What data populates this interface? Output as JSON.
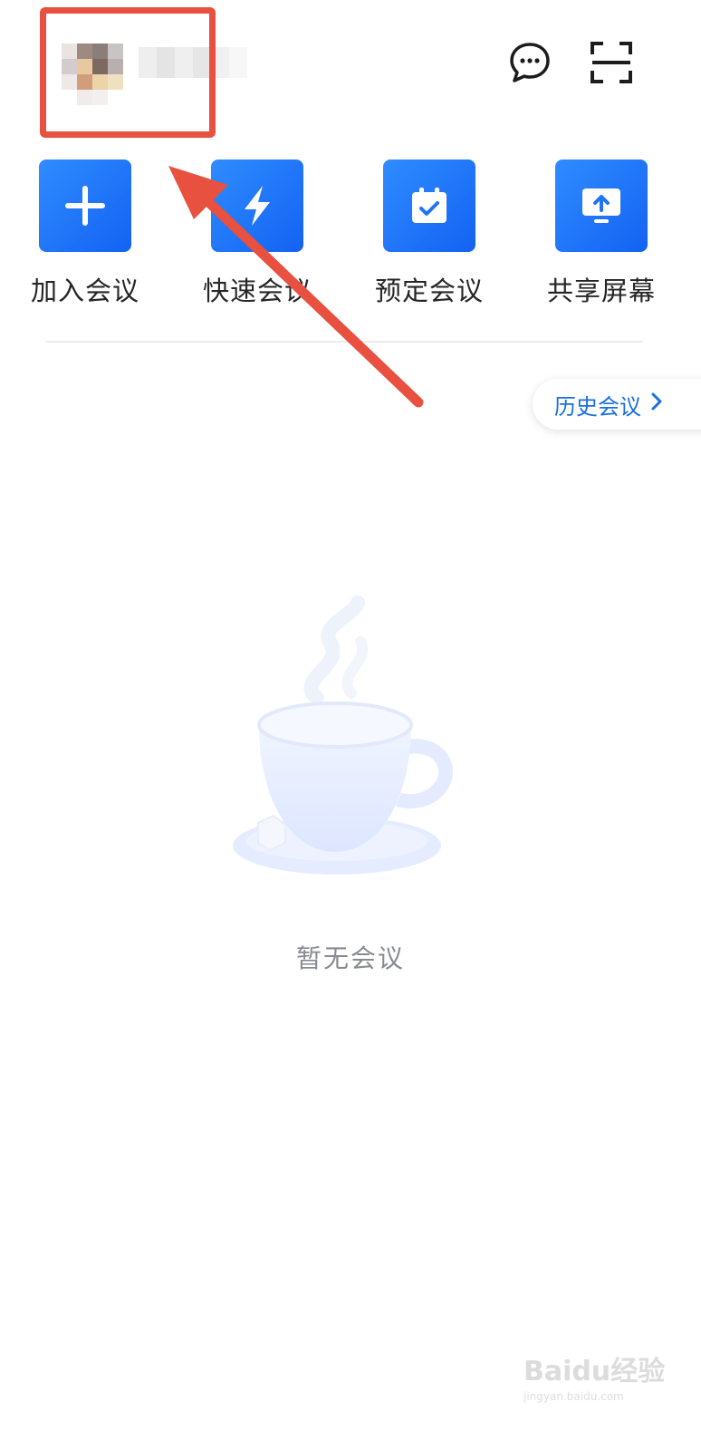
{
  "header": {
    "avatar_icon": "avatar-pixelated",
    "username": "",
    "message_icon": "chat-bubble-icon",
    "scan_icon": "scan-icon"
  },
  "actions": [
    {
      "label": "加入会议",
      "icon": "plus-icon"
    },
    {
      "label": "快速会议",
      "icon": "lightning-icon"
    },
    {
      "label": "预定会议",
      "icon": "calendar-check-icon"
    },
    {
      "label": "共享屏幕",
      "icon": "screen-share-icon"
    }
  ],
  "history": {
    "label": "历史会议",
    "icon": "chevron-right-icon"
  },
  "empty_state": {
    "text": "暂无会议",
    "icon": "coffee-cup-illustration"
  },
  "annotation": {
    "highlight_color": "#e8503f"
  },
  "watermark": {
    "brand": "Baidu经验",
    "url": "jingyan.baidu.com"
  },
  "colors": {
    "accent": "#1a6fe0",
    "tile": "#1f74f7"
  }
}
